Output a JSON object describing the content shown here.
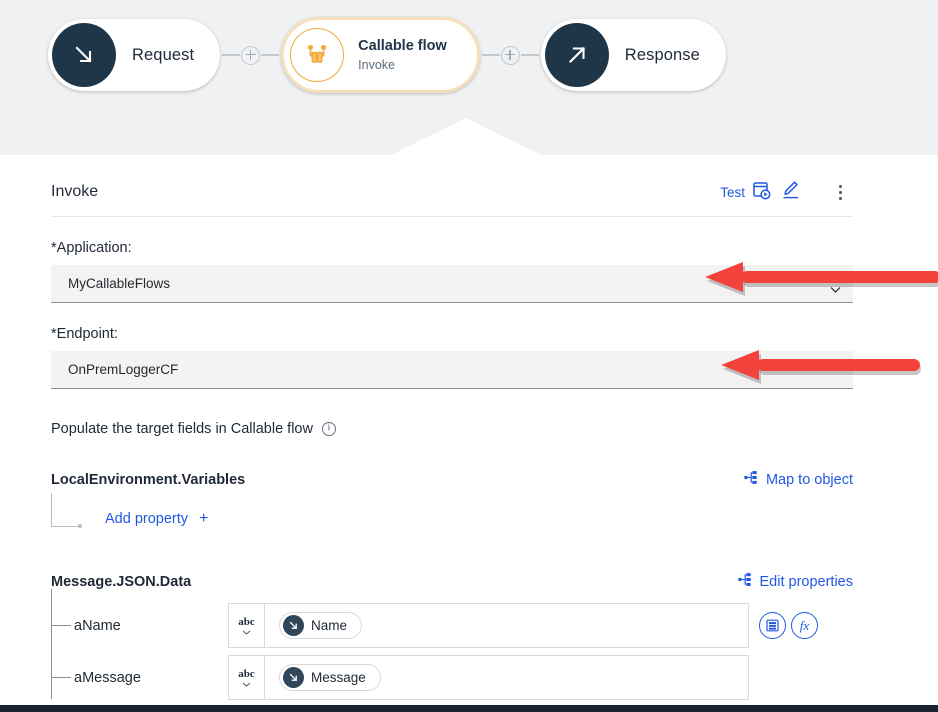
{
  "flow": {
    "nodes": [
      {
        "label": "Request",
        "icon": "arrow-down-right-icon"
      },
      {
        "title": "Callable flow",
        "subtitle": "Invoke",
        "icon": "callable-flow-icon"
      },
      {
        "label": "Response",
        "icon": "arrow-up-right-icon"
      }
    ],
    "add_node_tooltip": "+"
  },
  "panel": {
    "title": "Invoke",
    "actions": {
      "test_label": "Test",
      "test_icon": "test-flow-icon",
      "edit_icon": "pencil-icon",
      "overflow_icon": "kebab-menu-icon"
    },
    "fields": [
      {
        "label": "*Application:",
        "value": "MyCallableFlows",
        "control": "dropdown"
      },
      {
        "label": "*Endpoint:",
        "value": "OnPremLoggerCF",
        "control": "text"
      }
    ],
    "populate": {
      "text": "Populate the target fields in Callable flow",
      "info_icon": "info-icon"
    },
    "sections": [
      {
        "title": "LocalEnvironment.Variables",
        "action_label": "Map to object",
        "action_icon": "map-object-icon",
        "add_property_label": "Add property",
        "add_property_plus": "+"
      },
      {
        "title": "Message.JSON.Data",
        "action_label": "Edit properties",
        "action_icon": "map-object-icon"
      }
    ],
    "properties": [
      {
        "name": "aName",
        "type_label": "abc",
        "chip_label": "Name",
        "chip_icon": "arrow-down-right-icon",
        "actions": [
          "list-icon",
          "fx-icon"
        ]
      },
      {
        "name": "aMessage",
        "type_label": "abc",
        "chip_label": "Message",
        "chip_icon": "arrow-down-right-icon",
        "actions": []
      }
    ]
  },
  "annotations": {
    "arrows": [
      {
        "name": "application-field-arrow",
        "color": "#f4433c"
      },
      {
        "name": "endpoint-field-arrow",
        "color": "#f4433c"
      }
    ]
  },
  "colors": {
    "canvas_bg": "#f0f1f3",
    "node_dark": "#1f3648",
    "accent_orange": "#f0a93b",
    "link_blue": "#2158e3",
    "annotation_red": "#f4433c"
  }
}
